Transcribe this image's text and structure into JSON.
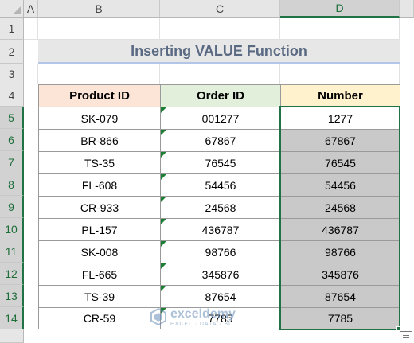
{
  "columns": [
    "A",
    "B",
    "C",
    "D"
  ],
  "rows": [
    "1",
    "2",
    "3",
    "4",
    "5",
    "6",
    "7",
    "8",
    "9",
    "10",
    "11",
    "12",
    "13",
    "14"
  ],
  "title": "Inserting VALUE Function",
  "headers": {
    "product_id": "Product ID",
    "order_id": "Order ID",
    "number": "Number"
  },
  "table": [
    {
      "product": "SK-079",
      "order": "001277",
      "number": "1277"
    },
    {
      "product": "BR-866",
      "order": "67867",
      "number": "67867"
    },
    {
      "product": "TS-35",
      "order": "76545",
      "number": "76545"
    },
    {
      "product": "FL-608",
      "order": "54456",
      "number": "54456"
    },
    {
      "product": "CR-933",
      "order": "24568",
      "number": "24568"
    },
    {
      "product": "PL-157",
      "order": "436787",
      "number": "436787"
    },
    {
      "product": "SK-008",
      "order": "98766",
      "number": "98766"
    },
    {
      "product": "FL-665",
      "order": "345876",
      "number": "345876"
    },
    {
      "product": "TS-39",
      "order": "87654",
      "number": "87654"
    },
    {
      "product": "CR-59",
      "order": "7785",
      "number": "7785"
    }
  ],
  "watermark": {
    "name": "exceldemy",
    "sub": "EXCEL · DATA · BI"
  },
  "colors": {
    "selection": "#217346",
    "title_underline": "#b4c6e7",
    "grey_fill": "#c9c9c9"
  }
}
